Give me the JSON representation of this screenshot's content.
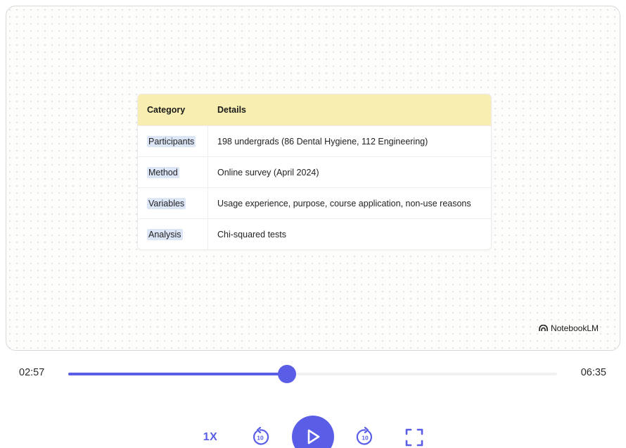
{
  "table": {
    "header": {
      "category": "Category",
      "details": "Details"
    },
    "rows": [
      {
        "category": "Participants",
        "details": "198 undergrads (86 Dental Hygiene, 112 Engineering)"
      },
      {
        "category": "Method",
        "details": "Online survey (April 2024)"
      },
      {
        "category": "Variables",
        "details": "Usage experience, purpose, course application, non-use reasons"
      },
      {
        "category": "Analysis",
        "details": "Chi-squared tests"
      }
    ]
  },
  "brand": {
    "name": "NotebookLM",
    "icon": "notebooklm-logo-icon"
  },
  "player": {
    "current_time": "02:57",
    "total_time": "06:35",
    "progress_fraction": 0.448,
    "speed_label": "1X",
    "rewind_seconds": "10",
    "forward_seconds": "10",
    "accent_color": "#5a5ee6",
    "icons": {
      "rewind": "rewind-10-icon",
      "play": "play-icon",
      "forward": "forward-10-icon",
      "fullscreen": "fullscreen-icon"
    }
  }
}
